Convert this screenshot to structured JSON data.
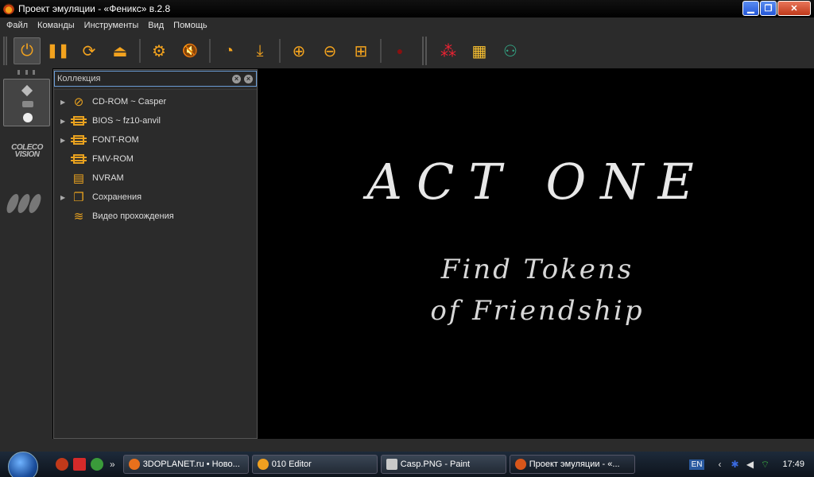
{
  "window": {
    "title": "Проект эмуляции - «Феникс» в.2.8",
    "minimize": "▁",
    "maximize": "❐",
    "close": "✕"
  },
  "menu": [
    "Файл",
    "Команды",
    "Инструменты",
    "Вид",
    "Помощь"
  ],
  "toolbar": {
    "buttons": [
      {
        "name": "power-icon",
        "glyph": "⏻",
        "active": true
      },
      {
        "name": "pause-icon",
        "glyph": "❚❚"
      },
      {
        "name": "reset-icon",
        "glyph": "⟳"
      },
      {
        "name": "eject-icon",
        "glyph": "⏏"
      },
      {
        "name": "settings-gear-icon",
        "glyph": "⚙"
      },
      {
        "name": "mute-icon",
        "glyph": "🔇"
      },
      {
        "name": "speed-gauge-icon",
        "glyph": "◔"
      },
      {
        "name": "load-state-icon",
        "glyph": "⤓"
      },
      {
        "name": "zoom-in-icon",
        "glyph": "⊕"
      },
      {
        "name": "zoom-out-icon",
        "glyph": "⊖"
      },
      {
        "name": "fit-screen-icon",
        "glyph": "⊞"
      },
      {
        "name": "record-icon",
        "glyph": "●"
      },
      {
        "name": "palette-icon",
        "glyph": "⁂"
      },
      {
        "name": "color-grid-icon",
        "glyph": "▦"
      },
      {
        "name": "rgb-filter-icon",
        "glyph": "⚇"
      }
    ]
  },
  "platforms": {
    "coleco_line1": "COLECO",
    "coleco_line2": "VISION"
  },
  "collection": {
    "search_placeholder": "Коллекция",
    "items": [
      {
        "label": "CD-ROM ~ Casper",
        "expandable": true,
        "icon": "cd-icon"
      },
      {
        "label": "BIOS ~ fz10-anvil",
        "expandable": true,
        "icon": "chip-icon"
      },
      {
        "label": "FONT-ROM",
        "expandable": true,
        "icon": "chip-icon"
      },
      {
        "label": "FMV-ROM",
        "expandable": false,
        "icon": "chip-icon"
      },
      {
        "label": "NVRAM",
        "expandable": false,
        "icon": "memory-card-icon"
      },
      {
        "label": "Сохранения",
        "expandable": true,
        "icon": "save-states-icon"
      },
      {
        "label": "Видео прохождения",
        "expandable": false,
        "icon": "video-walkthrough-icon"
      }
    ]
  },
  "screen": {
    "title": "ACT ONE",
    "subtitle_line1": "Find Tokens",
    "subtitle_line2": "of Friendship"
  },
  "taskbar": {
    "tasks": [
      {
        "label": "3DOPLANET.ru • Ново...",
        "color": "#e8701c"
      },
      {
        "label": "010 Editor",
        "color": "#f0a020"
      },
      {
        "label": "Casp.PNG - Paint",
        "color": "#c9c9c9"
      },
      {
        "label": "Проект эмуляции - «...",
        "color": "#d8561a"
      }
    ],
    "lang": "EN",
    "clock": "17:49",
    "chevron": "»"
  }
}
